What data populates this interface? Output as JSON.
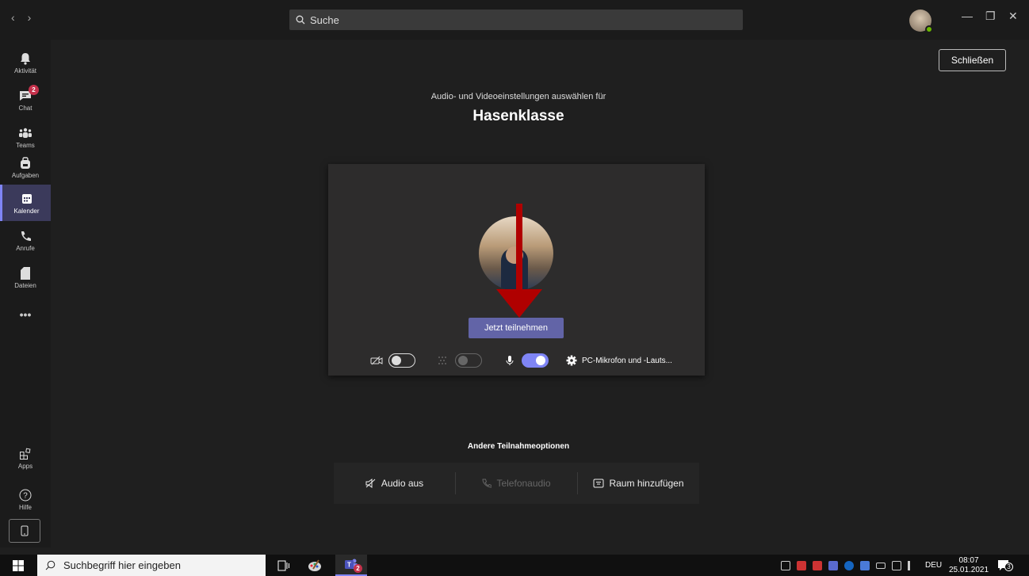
{
  "titlebar": {
    "back_arrow": "‹",
    "forward_arrow": "›",
    "search_placeholder": "Suche",
    "minimize": "—",
    "maximize": "❐",
    "close": "✕"
  },
  "rail": {
    "items": [
      {
        "label": "Aktivität",
        "icon": "bell-icon"
      },
      {
        "label": "Chat",
        "icon": "chat-icon",
        "badge": "2"
      },
      {
        "label": "Teams",
        "icon": "teams-icon"
      },
      {
        "label": "Aufgaben",
        "icon": "backpack-icon"
      },
      {
        "label": "Kalender",
        "icon": "calendar-icon",
        "active": true
      },
      {
        "label": "Anrufe",
        "icon": "phone-icon"
      },
      {
        "label": "Dateien",
        "icon": "file-icon"
      },
      {
        "label": "•••",
        "icon": "more-icon"
      }
    ],
    "apps_label": "Apps",
    "help_label": "Hilfe"
  },
  "main": {
    "close_button": "Schließen",
    "subtitle": "Audio- und Videoeinstellungen auswählen für",
    "meeting_title": "Hasenklasse",
    "join_button": "Jetzt teilnehmen",
    "device_label": "PC-Mikrofon und -Lauts...",
    "toggles": {
      "camera": false,
      "blur": false,
      "mic": true
    },
    "other_options_title": "Andere Teilnahmeoptionen",
    "options": [
      {
        "label": "Audio aus",
        "icon": "speaker-off-icon",
        "disabled": false
      },
      {
        "label": "Telefonaudio",
        "icon": "phone-icon",
        "disabled": true
      },
      {
        "label": "Raum hinzufügen",
        "icon": "room-icon",
        "disabled": false
      }
    ]
  },
  "colors": {
    "accent": "#6264a7",
    "arrow": "#b00000",
    "badge": "#c4314b"
  },
  "taskbar": {
    "search_placeholder": "Suchbegriff hier eingeben",
    "teams_badge": "2",
    "language": "DEU",
    "time": "08:07",
    "date": "25.01.2021",
    "notifications": "3"
  }
}
